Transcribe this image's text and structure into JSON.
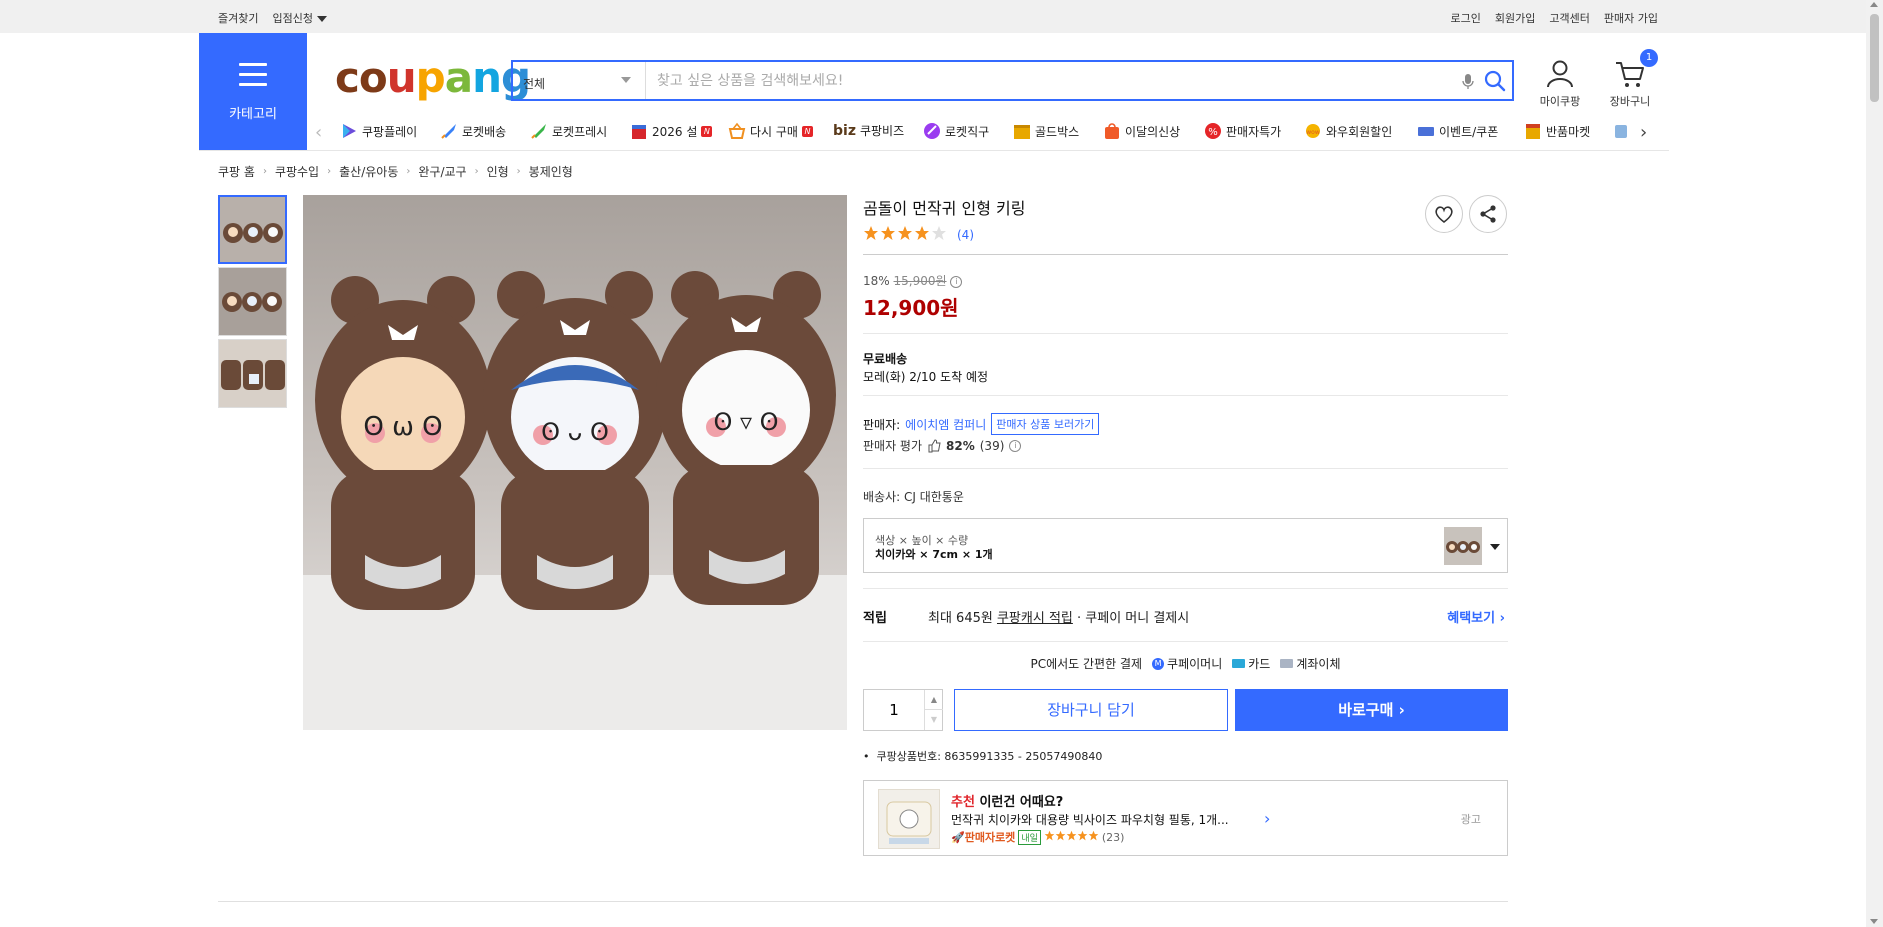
{
  "topbar": {
    "left": [
      "즐겨찾기",
      "입점신청"
    ],
    "right": [
      "로그인",
      "회원가입",
      "고객센터",
      "판매자 가입"
    ]
  },
  "header": {
    "category_label": "카테고리",
    "logo": [
      "c",
      "o",
      "u",
      "p",
      "a",
      "n",
      "g"
    ],
    "search_category": "전체",
    "search_placeholder": "찾고 싶은 상품을 검색해보세요!",
    "mycoupang": "마이쿠팡",
    "cart_label": "장바구니",
    "cart_count": "1"
  },
  "nav": [
    {
      "label": "쿠팡플레이",
      "icon": "play-icon",
      "color": "#6b4ddb"
    },
    {
      "label": "로켓배송",
      "icon": "rocket-icon",
      "color": "#3a82f7"
    },
    {
      "label": "로켓프레시",
      "icon": "rocket-fresh-icon",
      "color": "#3ab54a"
    },
    {
      "label": "2026 설",
      "icon": "gift-icon",
      "color": "#d6262c",
      "badge": "N"
    },
    {
      "label": "다시 구매",
      "icon": "basket-icon",
      "color": "#f09020",
      "badge": "N"
    },
    {
      "label": "쿠팡비즈",
      "icon": "biz-icon",
      "color": "#5a3a1a",
      "prefix": "biz"
    },
    {
      "label": "로켓직구",
      "icon": "global-icon",
      "color": "#9a3cf0"
    },
    {
      "label": "골드박스",
      "icon": "goldbox-icon",
      "color": "#e8a800"
    },
    {
      "label": "이달의신상",
      "icon": "new-icon",
      "color": "#f05a28"
    },
    {
      "label": "판매자특가",
      "icon": "percent-icon",
      "color": "#e52528"
    },
    {
      "label": "와우회원할인",
      "icon": "wow-icon",
      "color": "#e05a20"
    },
    {
      "label": "이벤트/쿠폰",
      "icon": "coupon-icon",
      "color": "#4a70d8"
    },
    {
      "label": "반품마켓",
      "icon": "market-icon",
      "color": "#e8a800"
    }
  ],
  "breadcrumb": [
    "쿠팡 홈",
    "쿠팡수입",
    "출산/유아동",
    "완구/교구",
    "인형",
    "봉제인형"
  ],
  "product": {
    "title": "곰돌이 먼작귀 인형 키링",
    "rating": 4,
    "review_count": "(4)",
    "discount_rate": "18%",
    "original_price": "15,900원",
    "price": "12,900원",
    "shipping_title": "무료배송",
    "shipping_date": "모레(화) 2/10 도착 예정",
    "seller_label": "판매자:",
    "seller_name": "에이치엠 컴퍼니",
    "seller_button": "판매자 상품 보러가기",
    "seller_rating_label": "판매자 평가",
    "seller_rating_pct": "82%",
    "seller_rating_count": "(39)",
    "carrier": "배송사: CJ 대한통운",
    "option_label": "색상 × 높이 × 수량",
    "option_value": "치이카와 × 7cm × 1개",
    "points_label": "적립",
    "points_text_1": "최대 645원",
    "points_text_2": "쿠팡캐시 적립",
    "points_text_3": "· 쿠페이 머니 결제시",
    "points_benefit": "혜택보기",
    "pay_pc": "PC에서도 간편한 결제",
    "pay_methods": [
      "쿠페이머니",
      "카드",
      "계좌이체"
    ],
    "quantity": "1",
    "add_to_cart": "장바구니 담기",
    "buy_now": "바로구매",
    "product_id": "쿠팡상품번호: 8635991335 - 25057490840"
  },
  "recommend": {
    "title_red": "추천",
    "title_rest": "이런건 어때요?",
    "name": "먼작귀 치이카와 대용량 빅사이즈 파우치형 필통, 1개...",
    "seller_rocket": "판매자로켓",
    "tomorrow": "내일",
    "review_count": "(23)",
    "ad": "광고"
  }
}
